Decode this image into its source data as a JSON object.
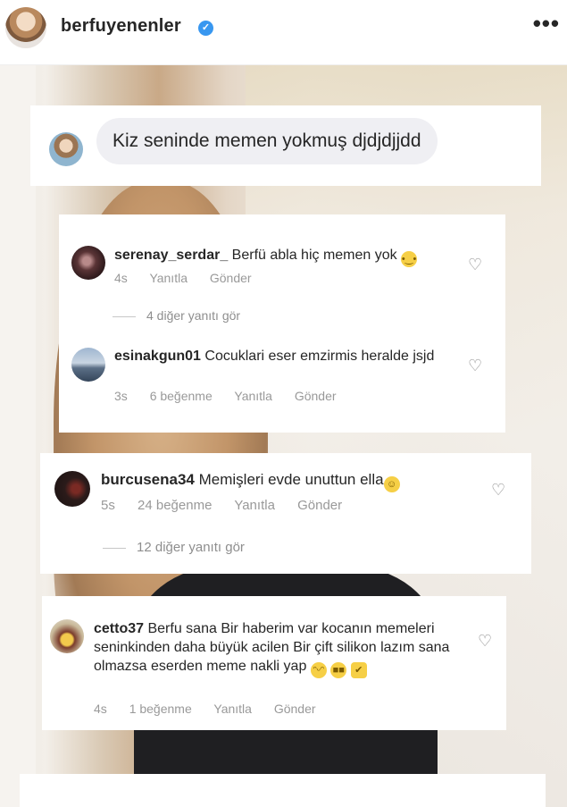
{
  "header": {
    "username": "berfuyenenler",
    "verified_icon": "verified-badge-icon",
    "more_icon": "more-options-icon",
    "more_label": "•••"
  },
  "story_reply": {
    "text": "Kiz seninde memen yokmuş djdjdjjdd"
  },
  "comments": [
    {
      "username": "serenay_serdar_",
      "text": "Berfü abla hiç memen yok",
      "emoji": "crying-face-emoji",
      "time": "4s",
      "likes": "",
      "reply": "Yanıtla",
      "send": "Gönder",
      "more_replies": "4 diğer yanıtı gör"
    },
    {
      "username": "esinakgun01",
      "text": "Cocuklari eser emzirmis heralde jsjd",
      "time": "3s",
      "likes": "6 beğenme",
      "reply": "Yanıtla",
      "send": "Gönder"
    },
    {
      "username": "burcusena34",
      "text": "Memişleri evde unuttun ella",
      "emoji": "laughing-emoji",
      "time": "5s",
      "likes": "24 beğenme",
      "reply": "Yanıtla",
      "send": "Gönder",
      "more_replies": "12 diğer yanıtı gör"
    },
    {
      "username": "cetto37",
      "text": "Berfu sana Bir haberim var kocanın memeleri seninkinden daha büyük acilen Bir çift silikon lazım sana olmazsa eserden meme nakli yap",
      "emojis": [
        "grimacing-emoji",
        "sunglasses-emoji",
        "thumbs-up-emoji"
      ],
      "time": "4s",
      "likes": "1 beğenme",
      "reply": "Yanıtla",
      "send": "Gönder"
    }
  ],
  "colors": {
    "verified": "#3897f0",
    "bubble": "#efeff3",
    "meta_text": "#999999"
  }
}
